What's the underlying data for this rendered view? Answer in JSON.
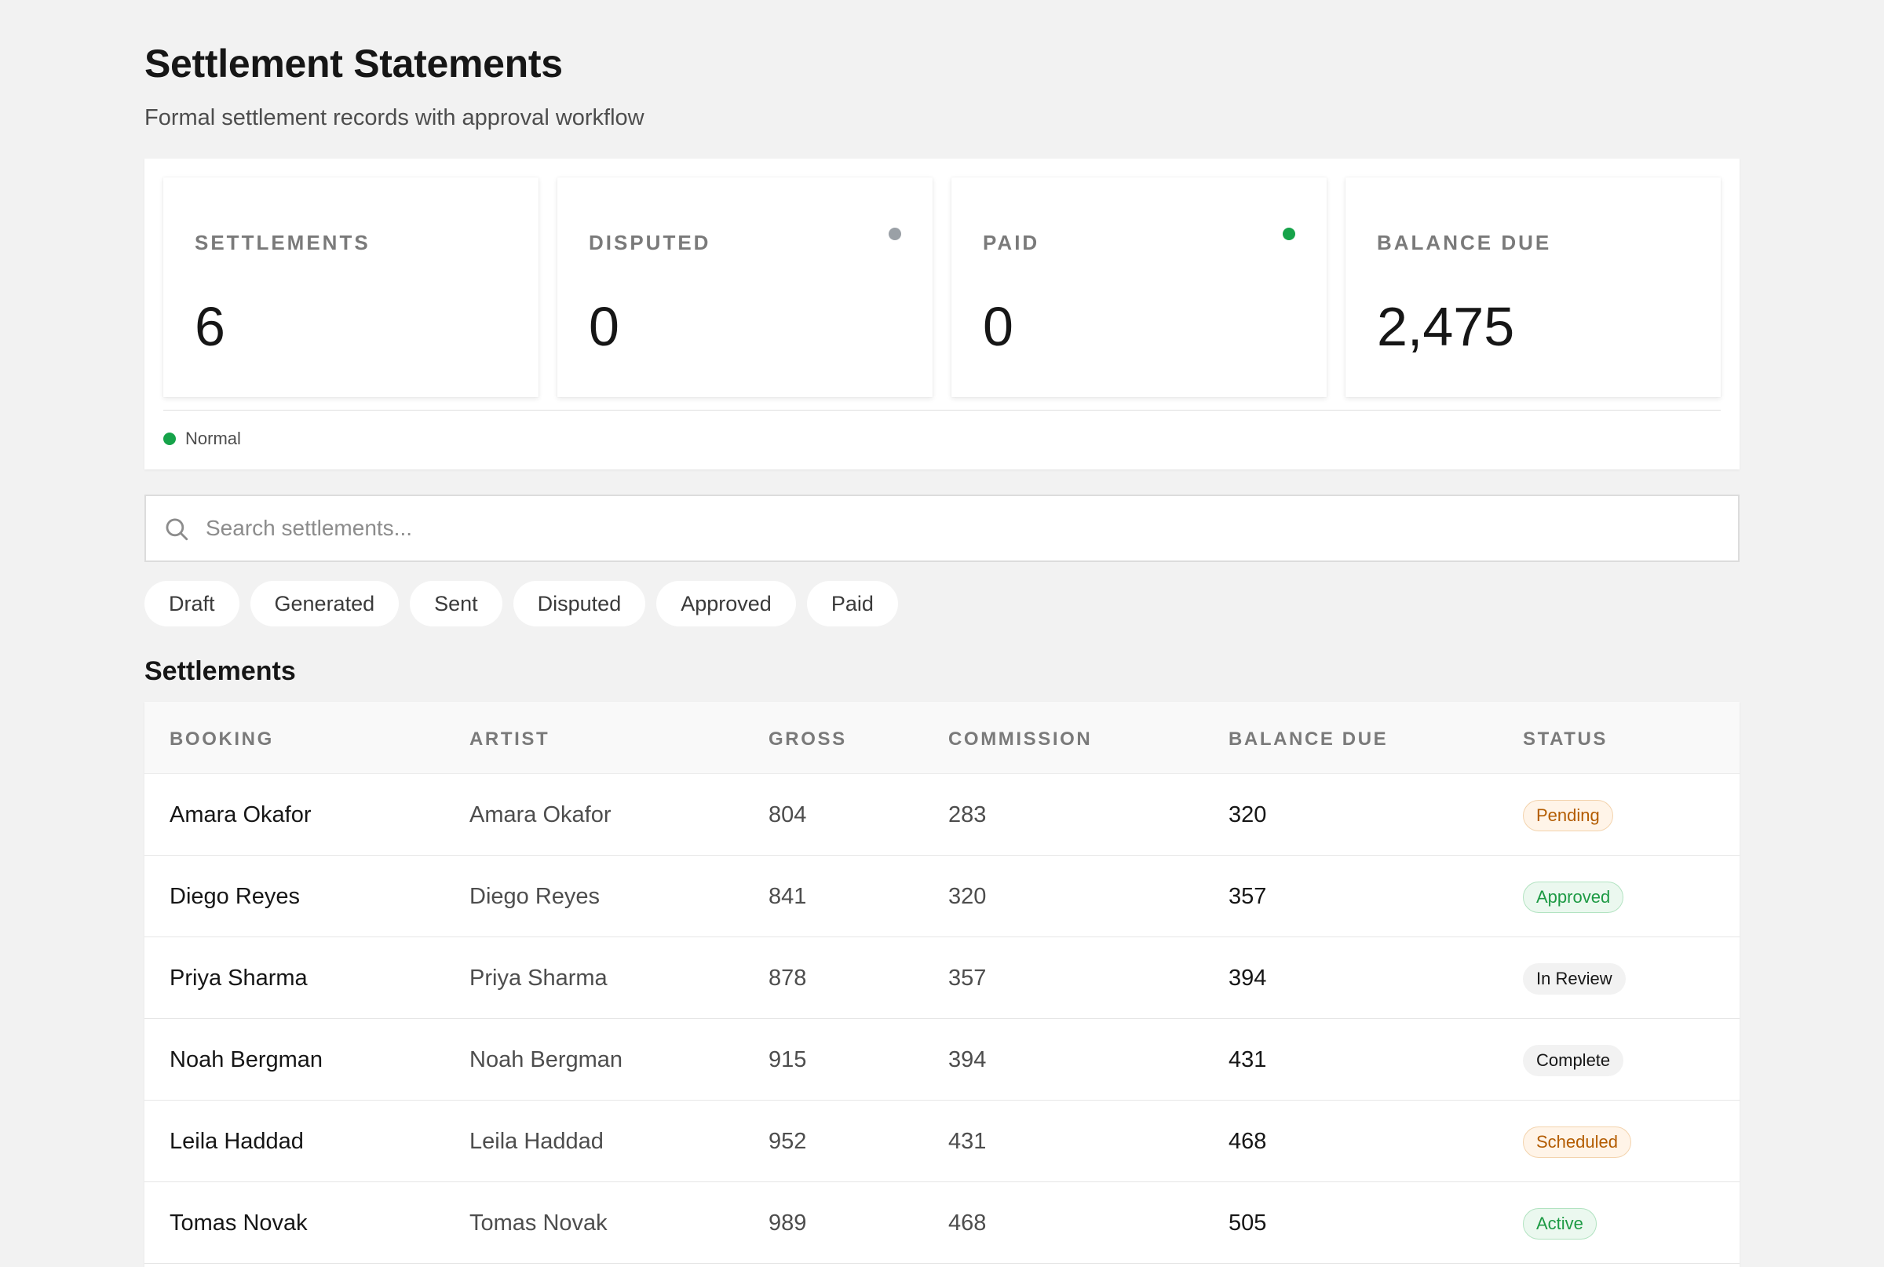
{
  "header": {
    "title": "Settlement Statements",
    "subtitle": "Formal settlement records with approval workflow"
  },
  "metrics": [
    {
      "label": "SETTLEMENTS",
      "value": "6",
      "dot_color": null
    },
    {
      "label": "DISPUTED",
      "value": "0",
      "dot_color": "#9aa0a6"
    },
    {
      "label": "PAID",
      "value": "0",
      "dot_color": "#16a34a"
    },
    {
      "label": "BALANCE DUE",
      "value": "2,475",
      "dot_color": null
    }
  ],
  "legend": {
    "label": "Normal",
    "color": "#16a34a"
  },
  "search": {
    "placeholder": "Search settlements...",
    "value": ""
  },
  "filters": [
    "Draft",
    "Generated",
    "Sent",
    "Disputed",
    "Approved",
    "Paid"
  ],
  "table": {
    "title": "Settlements",
    "columns": [
      "BOOKING",
      "ARTIST",
      "GROSS",
      "COMMISSION",
      "BALANCE DUE",
      "STATUS"
    ],
    "rows": [
      {
        "booking": "Amara Okafor",
        "artist": "Amara Okafor",
        "gross": "804",
        "commission": "283",
        "balance": "320",
        "status": "Pending",
        "status_tone": "orange"
      },
      {
        "booking": "Diego Reyes",
        "artist": "Diego Reyes",
        "gross": "841",
        "commission": "320",
        "balance": "357",
        "status": "Approved",
        "status_tone": "green"
      },
      {
        "booking": "Priya Sharma",
        "artist": "Priya Sharma",
        "gross": "878",
        "commission": "357",
        "balance": "394",
        "status": "In Review",
        "status_tone": "gray"
      },
      {
        "booking": "Noah Bergman",
        "artist": "Noah Bergman",
        "gross": "915",
        "commission": "394",
        "balance": "431",
        "status": "Complete",
        "status_tone": "gray"
      },
      {
        "booking": "Leila Haddad",
        "artist": "Leila Haddad",
        "gross": "952",
        "commission": "431",
        "balance": "468",
        "status": "Scheduled",
        "status_tone": "orange"
      },
      {
        "booking": "Tomas Novak",
        "artist": "Tomas Novak",
        "gross": "989",
        "commission": "468",
        "balance": "505",
        "status": "Active",
        "status_tone": "green"
      }
    ]
  }
}
